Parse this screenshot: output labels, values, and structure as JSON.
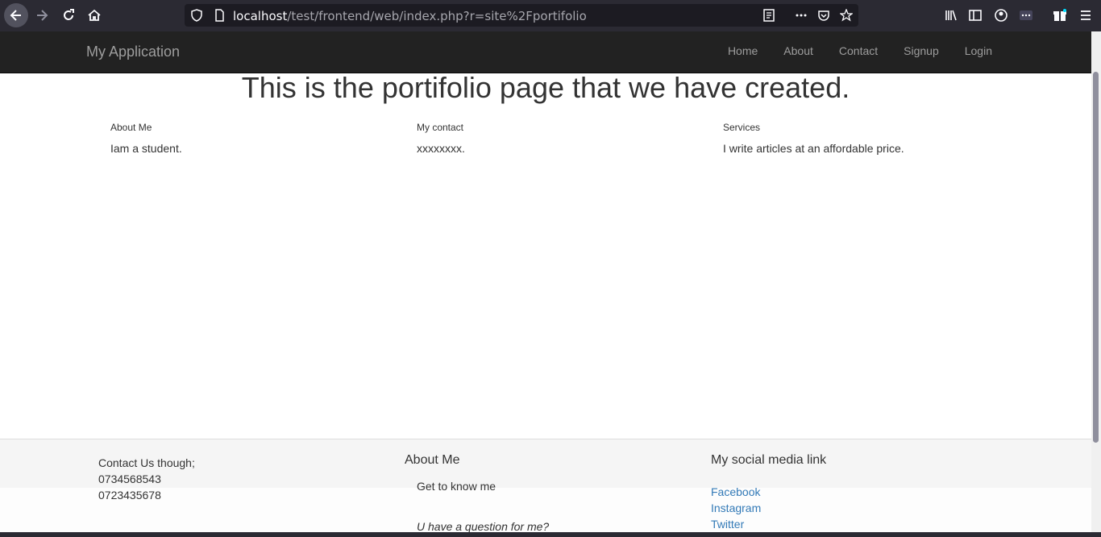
{
  "browser": {
    "url_host": "localhost",
    "url_path": "/test/frontend/web/index.php?r=site%2Fportifolio"
  },
  "navbar": {
    "brand": "My Application",
    "links": [
      "Home",
      "About",
      "Contact",
      "Signup",
      "Login"
    ]
  },
  "main": {
    "title": "This is the portifolio page that we have created.",
    "columns": [
      {
        "heading": "About Me",
        "text": "Iam a student."
      },
      {
        "heading": "My contact",
        "text": "xxxxxxxx."
      },
      {
        "heading": "Services",
        "text": "I write articles at an affordable price."
      }
    ]
  },
  "footer": {
    "contact": {
      "label": "Contact Us though;",
      "phones": [
        "0734568543",
        "0723435678"
      ]
    },
    "about": {
      "heading": "About Me",
      "subtitle": "Get to know me",
      "question": "U have a question for me?"
    },
    "social": {
      "heading": "My social media link",
      "links": [
        "Facebook",
        "Instagram",
        "Twitter"
      ]
    }
  }
}
